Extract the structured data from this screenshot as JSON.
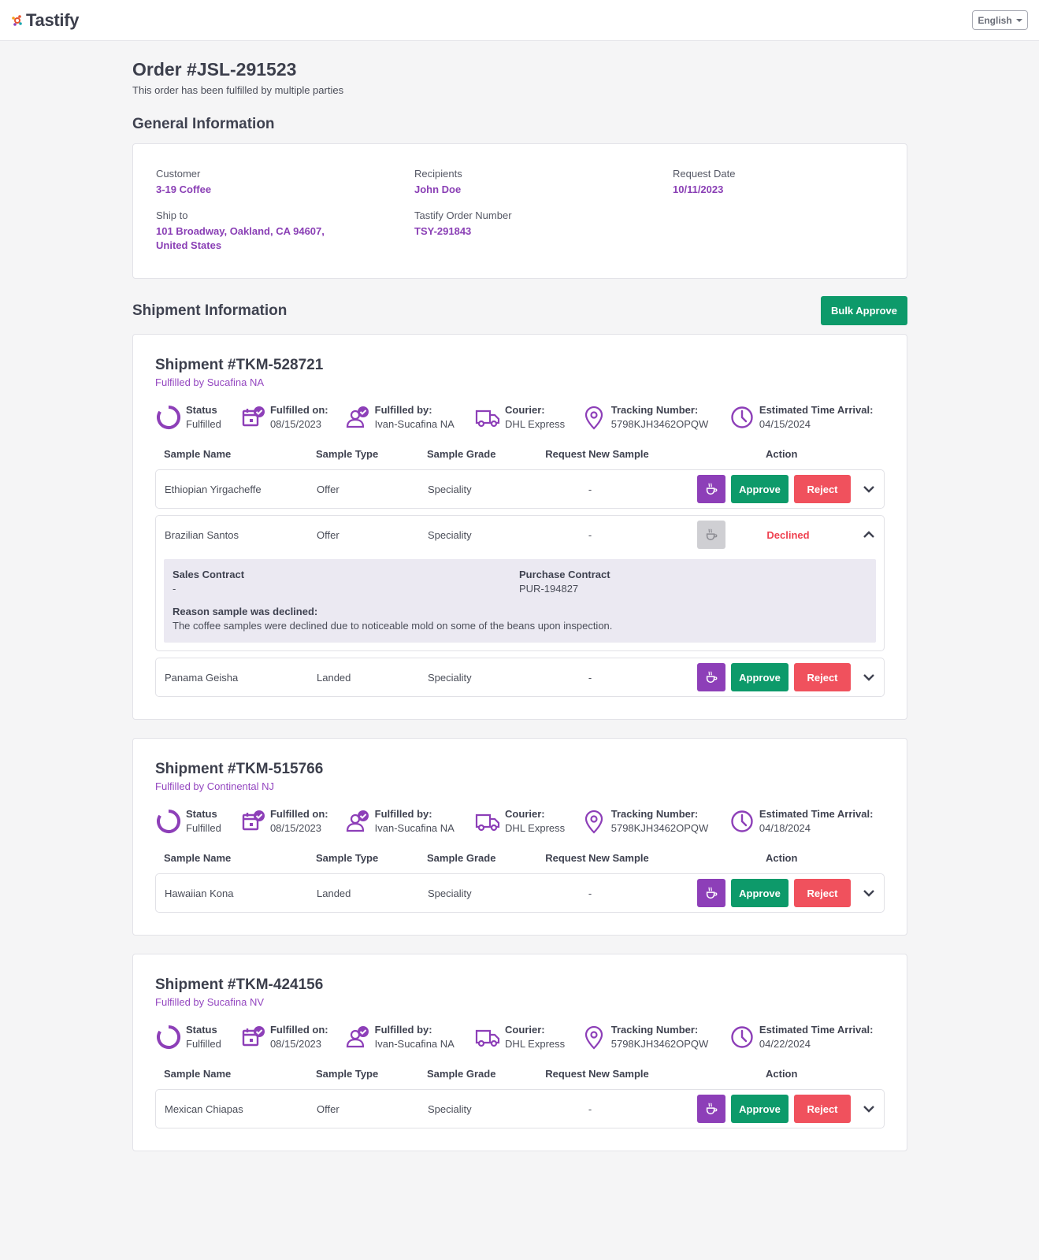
{
  "header": {
    "logo_text": "Tastify",
    "language": "English"
  },
  "order": {
    "title": "Order #JSL-291523",
    "subtitle": "This order has been fulfilled by multiple parties"
  },
  "general": {
    "title": "General Information",
    "customer_label": "Customer",
    "customer": "3-19 Coffee",
    "recipients_label": "Recipients",
    "recipients": "John Doe",
    "request_date_label": "Request Date",
    "request_date": "10/11/2023",
    "ship_to_label": "Ship to",
    "ship_to_line1": "101 Broadway, Oakland, CA 94607,",
    "ship_to_line2": "United States",
    "tastify_order_label": "Tastify Order Number",
    "tastify_order": "TSY-291843"
  },
  "shipment_info": {
    "title": "Shipment Information",
    "bulk_approve": "Bulk Approve"
  },
  "labels": {
    "status": "Status",
    "fulfilled_on": "Fulfilled on:",
    "fulfilled_by": "Fulfilled by:",
    "courier": "Courier:",
    "tracking": "Tracking Number:",
    "eta": "Estimated Time Arrival:",
    "col_name": "Sample Name",
    "col_type": "Sample Type",
    "col_grade": "Sample Grade",
    "col_req": "Request New Sample",
    "col_action": "Action",
    "approve": "Approve",
    "reject": "Reject",
    "declined": "Declined",
    "sales_contract": "Sales Contract",
    "purchase_contract": "Purchase Contract",
    "reason": "Reason sample was declined:"
  },
  "colors": {
    "brand": "#8d3fb8",
    "approve": "#0d9a6a",
    "reject": "#f0515d"
  },
  "shipments": [
    {
      "title": "Shipment #TKM-528721",
      "fulfilled_by_line": "Fulfilled by Sucafina NA",
      "status": "Fulfilled",
      "fulfilled_on": "08/15/2023",
      "fulfilled_by": "Ivan-Sucafina NA",
      "courier": "DHL Express",
      "tracking": "5798KJH3462OPQW",
      "eta": "04/15/2024",
      "rows": [
        {
          "name": "Ethiopian Yirgacheffe",
          "type": "Offer",
          "grade": "Speciality",
          "req": "-",
          "state": "pending"
        },
        {
          "name": "Brazilian Santos",
          "type": "Offer",
          "grade": "Speciality",
          "req": "-",
          "state": "declined",
          "sales_contract": "-",
          "purchase_contract": "PUR-194827",
          "reason": "The coffee samples were declined due to noticeable mold on some of the beans upon inspection."
        },
        {
          "name": "Panama Geisha",
          "type": "Landed",
          "grade": "Speciality",
          "req": "-",
          "state": "pending"
        }
      ]
    },
    {
      "title": "Shipment #TKM-515766",
      "fulfilled_by_line": "Fulfilled by Continental NJ",
      "status": "Fulfilled",
      "fulfilled_on": "08/15/2023",
      "fulfilled_by": "Ivan-Sucafina NA",
      "courier": "DHL Express",
      "tracking": "5798KJH3462OPQW",
      "eta": "04/18/2024",
      "rows": [
        {
          "name": "Hawaiian Kona",
          "type": "Landed",
          "grade": "Speciality",
          "req": "-",
          "state": "pending"
        }
      ]
    },
    {
      "title": "Shipment #TKM-424156",
      "fulfilled_by_line": "Fulfilled by Sucafina NV",
      "status": "Fulfilled",
      "fulfilled_on": "08/15/2023",
      "fulfilled_by": "Ivan-Sucafina NA",
      "courier": "DHL Express",
      "tracking": "5798KJH3462OPQW",
      "eta": "04/22/2024",
      "rows": [
        {
          "name": "Mexican Chiapas",
          "type": "Offer",
          "grade": "Speciality",
          "req": "-",
          "state": "pending"
        }
      ]
    }
  ]
}
